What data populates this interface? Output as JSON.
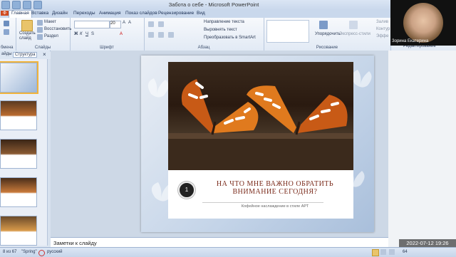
{
  "window": {
    "title": "Забота о себе - Microsoft PowerPoint"
  },
  "ribbon": {
    "tabs": [
      "Главная",
      "Вставка",
      "Дизайн",
      "Переходы",
      "Анимация",
      "Показ слайдов",
      "Рецензирование",
      "Вид"
    ],
    "active_tab": "Главная",
    "create_slide": "Создать слайд",
    "layout": "Макет",
    "reset": "Восстановить",
    "section": "Раздел",
    "font_size": "20",
    "text_direction": "Направление текста",
    "align_text": "Выровнять текст",
    "convert_smartart": "Преобразовать в SmartArt",
    "arrange": "Упорядочить",
    "quick_styles": "Экспресс-стили",
    "fill": "Залив",
    "outline": "Контур",
    "effects": "Эффе",
    "groups": {
      "clipboard": "Буфер обмена",
      "slides": "Слайды",
      "font": "Шрифт",
      "paragraph": "Абзац",
      "drawing": "Рисование",
      "editing": "Редактирование"
    }
  },
  "panel": {
    "tab_slides": "айды",
    "tab_outline": "Структура",
    "close": "×"
  },
  "slide": {
    "number_badge": "1",
    "heading": "НА ЧТО МНЕ ВАЖНО ОБРАТИТЬ ВНИМАНИЕ СЕГОДНЯ?",
    "subtitle": "Кофейное наслаждение в стиле АРТ"
  },
  "notes": {
    "placeholder": "Заметки к слайду"
  },
  "status": {
    "slide_counter": "8 из 67",
    "theme": "\"Spring\"",
    "language": "русский",
    "zoom": "64"
  },
  "video": {
    "participant_name": "Зорина Екатерина",
    "timestamp": "2022-07-12 19:26"
  }
}
